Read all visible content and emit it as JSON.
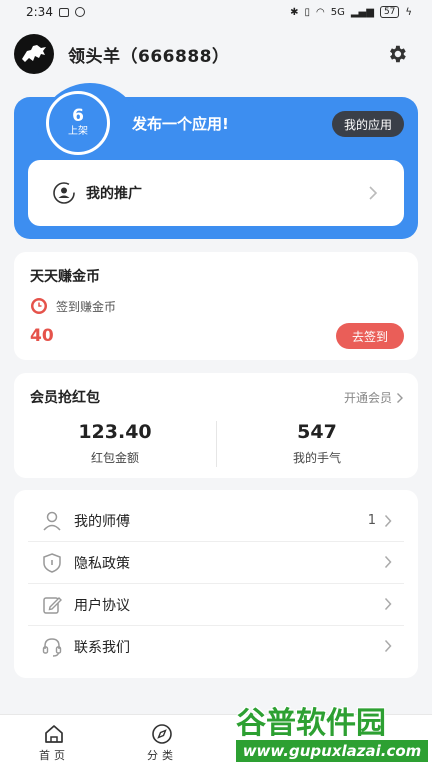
{
  "status_bar": {
    "time": "2:34",
    "battery": "57",
    "network": "5G"
  },
  "header": {
    "username": "领头羊（666888）"
  },
  "publish_card": {
    "count": "6",
    "count_label": "上架",
    "title": "发布一个应用!",
    "my_apps_button": "我的应用",
    "promotion_label": "我的推广"
  },
  "coin_card": {
    "title": "天天赚金币",
    "checkin_label": "签到赚金币",
    "coin_value": "40",
    "checkin_button": "去签到"
  },
  "red_packet_card": {
    "title": "会员抢红包",
    "open_vip": "开通会员",
    "amount_value": "123.40",
    "amount_label": "红包金额",
    "luck_value": "547",
    "luck_label": "我的手气"
  },
  "menu": {
    "items": [
      {
        "label": "我的师傅",
        "value": "1",
        "icon": "user-icon"
      },
      {
        "label": "隐私政策",
        "value": "",
        "icon": "shield-icon"
      },
      {
        "label": "用户协议",
        "value": "",
        "icon": "edit-icon"
      },
      {
        "label": "联系我们",
        "value": "",
        "icon": "headset-icon"
      }
    ]
  },
  "bottom_nav": {
    "home": "首页",
    "category": "分类"
  },
  "watermark": {
    "brand": "谷普软件园",
    "url": "www.gupuxlazai.com"
  },
  "colors": {
    "accent_blue": "#3d8ef0",
    "accent_red": "#ea5e58",
    "background": "#f4f5f7"
  }
}
